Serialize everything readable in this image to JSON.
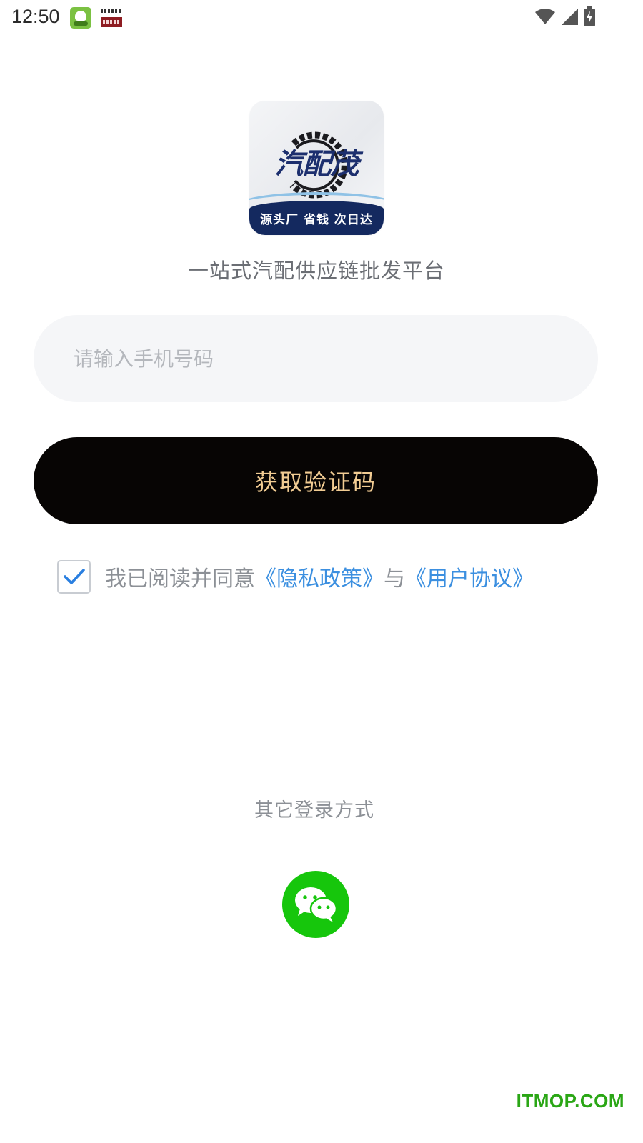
{
  "status_bar": {
    "time": "12:50",
    "icons": [
      "app-notification-icon",
      "news-notification-icon",
      "wifi-icon",
      "signal-icon",
      "battery-charging-icon"
    ]
  },
  "logo": {
    "wordmark": "汽配茂",
    "slogan": "源头厂  省钱  次日达",
    "colors": {
      "navy": "#14295f",
      "wordmark": "#1c2f6e",
      "wave": "#8fc2e6"
    }
  },
  "tagline": "一站式汽配供应链批发平台",
  "phone_input": {
    "value": "",
    "placeholder": "请输入手机号码"
  },
  "get_code_button": {
    "label": "获取验证码",
    "colors": {
      "background": "#070504",
      "text": "#f1cc93"
    }
  },
  "agreement": {
    "checked": true,
    "prefix": "我已阅读并同意",
    "privacy_link": "《隐私政策》",
    "joiner": "与",
    "terms_link": "《用户协议》",
    "link_color": "#3b8fe0"
  },
  "other_login": {
    "title": "其它登录方式",
    "wechat_icon": "wechat-icon",
    "wechat_color": "#16c60c"
  },
  "watermark": "ITMOP.COM"
}
